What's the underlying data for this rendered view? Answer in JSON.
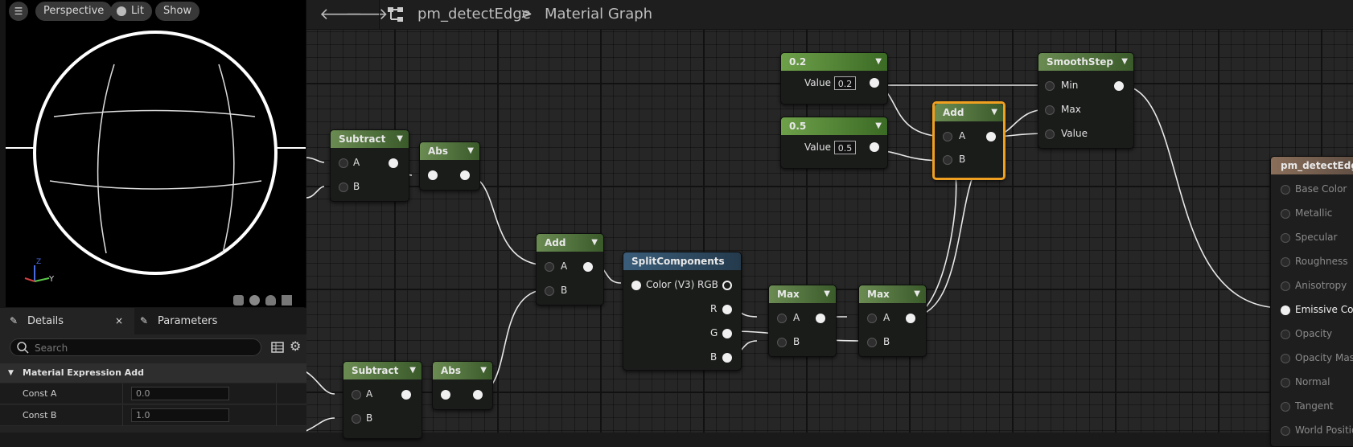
{
  "viewport": {
    "view_mode": "Perspective",
    "lighting": "Lit",
    "show": "Show",
    "axis_z": "Z",
    "axis_y": "Y"
  },
  "details_panel": {
    "tabs": [
      {
        "label": "Details",
        "icon": "pencil-icon"
      },
      {
        "label": "Parameters",
        "icon": "pencil-icon"
      }
    ],
    "search_placeholder": "Search",
    "section_title": "Material Expression Add",
    "properties": [
      {
        "label": "Const A",
        "value": "0.0"
      },
      {
        "label": "Const B",
        "value": "1.0"
      }
    ]
  },
  "toolbar": {
    "asset_name": "pm_detectEdge",
    "separator": ">",
    "graph_name": "Material Graph"
  },
  "nodes": {
    "const_02": {
      "title": "0.2",
      "label": "Value",
      "value": "0.2"
    },
    "const_05": {
      "title": "0.5",
      "label": "Value",
      "value": "0.5"
    },
    "smoothstep": {
      "title": "SmoothStep",
      "pins": [
        "Min",
        "Max",
        "Value"
      ]
    },
    "add_sel": {
      "title": "Add",
      "pins": [
        "A",
        "B"
      ]
    },
    "subtract1": {
      "title": "Subtract",
      "pins": [
        "A",
        "B"
      ]
    },
    "abs1": {
      "title": "Abs"
    },
    "add2": {
      "title": "Add",
      "pins": [
        "A",
        "B"
      ]
    },
    "split": {
      "title": "SplitComponents",
      "input": "Color (V3)",
      "outputs": [
        "RGB",
        "R",
        "G",
        "B"
      ]
    },
    "max1": {
      "title": "Max",
      "pins": [
        "A",
        "B"
      ]
    },
    "max2": {
      "title": "Max",
      "pins": [
        "A",
        "B"
      ]
    },
    "subtract2": {
      "title": "Subtract",
      "pins": [
        "A",
        "B"
      ]
    },
    "abs2": {
      "title": "Abs"
    },
    "material": {
      "title": "pm_detectEdge",
      "pins": [
        "Base Color",
        "Metallic",
        "Specular",
        "Roughness",
        "Anisotropy",
        "Emissive Color",
        "Opacity",
        "Opacity Mask",
        "Normal",
        "Tangent",
        "World Position"
      ]
    }
  }
}
